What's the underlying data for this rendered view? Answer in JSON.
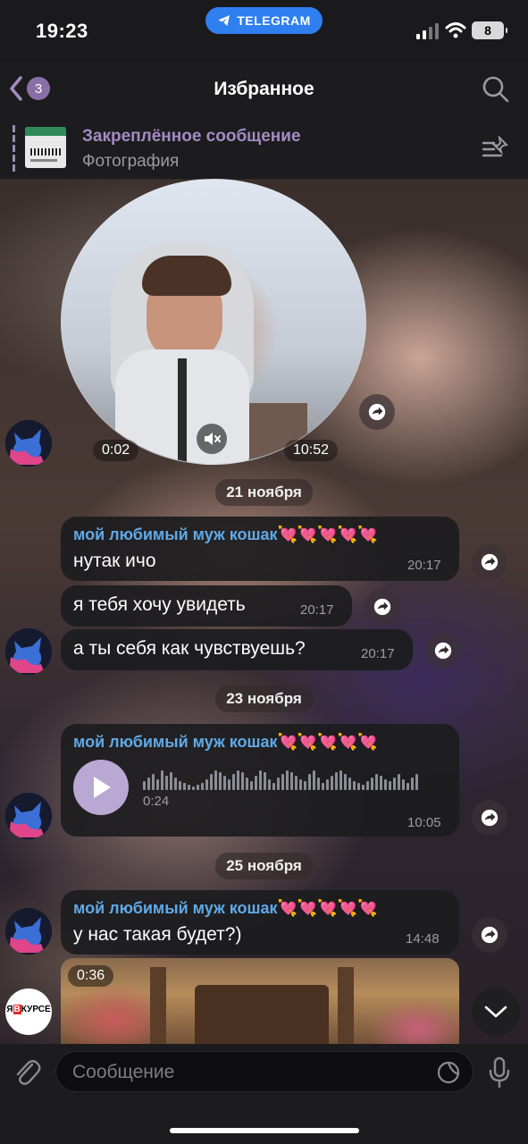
{
  "status_bar": {
    "time": "19:23",
    "app_pill": "TELEGRAM",
    "battery": "8"
  },
  "header": {
    "back_count": "3",
    "title": "Избранное"
  },
  "pinned": {
    "title": "Закреплённое сообщение",
    "subtitle": "Фотография"
  },
  "video_note": {
    "elapsed": "0:02",
    "time": "10:52"
  },
  "dates": {
    "d1": "21 ноября",
    "d2": "23 ноября",
    "d3": "25 ноября"
  },
  "messages": {
    "m1": {
      "sender": "мой любимый муж кошак💘💘💘💘💘",
      "text": "нутак ичо",
      "time": "20:17"
    },
    "m2": {
      "text": "я тебя хочу увидеть",
      "time": "20:17"
    },
    "m3": {
      "text": "а ты себя как чувствуешь?",
      "time": "20:17"
    },
    "m4": {
      "sender": "мой любимый муж кошак💘💘💘💘💘",
      "duration": "0:24",
      "time": "10:05"
    },
    "m5": {
      "sender": "мой любимый муж кошак💘💘💘💘💘",
      "text": "у нас такая будет?)",
      "time": "14:48"
    },
    "m6": {
      "duration": "0:36"
    }
  },
  "avatar_badge": {
    "text_left": "Я",
    "text_mid": "В",
    "text_right": "КУРСЕ"
  },
  "input": {
    "placeholder": "Сообщение"
  },
  "colors": {
    "accent": "#2f7ff0",
    "sender": "#5fa9e8",
    "pinned": "#a48bc4",
    "bubble": "#1c1c1e"
  }
}
